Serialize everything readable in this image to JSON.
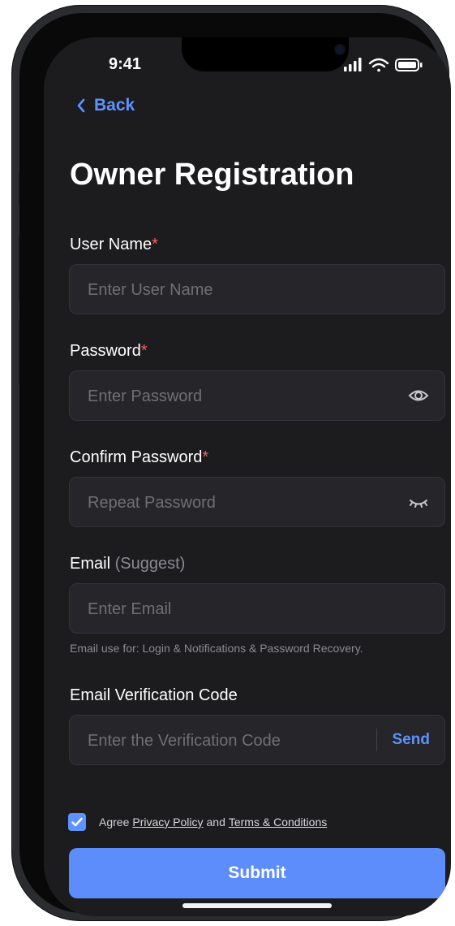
{
  "status": {
    "time": "9:41"
  },
  "nav": {
    "back_label": "Back"
  },
  "page": {
    "title": "Owner Registration"
  },
  "form": {
    "username": {
      "label": "User Name",
      "required_marker": "*",
      "placeholder": "Enter User Name",
      "value": ""
    },
    "password": {
      "label": "Password",
      "required_marker": "*",
      "placeholder": "Enter Password",
      "value": "",
      "icon": "eye-icon"
    },
    "confirm_password": {
      "label": "Confirm Password",
      "required_marker": "*",
      "placeholder": "Repeat Password",
      "value": "",
      "icon": "eye-closed-icon"
    },
    "email": {
      "label": "Email",
      "label_hint": "(Suggest)",
      "placeholder": "Enter Email",
      "value": "",
      "helper_text": "Email use for: Login & Notifications & Password Recovery."
    },
    "verification": {
      "label": "Email Verification Code",
      "placeholder": "Enter the Verification Code",
      "value": "",
      "send_label": "Send"
    }
  },
  "agreement": {
    "checked": true,
    "prefix": "Agree",
    "privacy_link": "Privacy Policy",
    "conjunction": "and",
    "terms_link": "Terms & Conditions"
  },
  "actions": {
    "submit_label": "Submit"
  },
  "colors": {
    "accent": "#5e93ff",
    "required": "#ff5a5a",
    "background": "#1c1c1e",
    "field": "#25252a"
  }
}
